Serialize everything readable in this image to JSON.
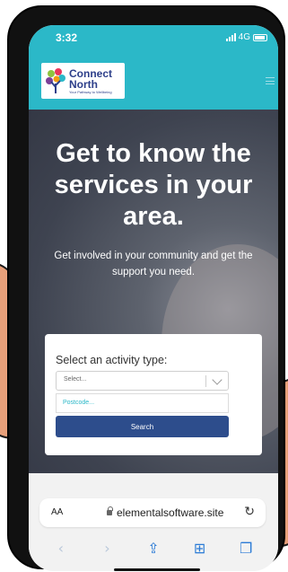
{
  "status": {
    "time": "3:32",
    "network": "4G"
  },
  "header": {
    "logo_title_line1": "Connect",
    "logo_title_line2": "North",
    "logo_tagline": "Your Pathway to Wellbeing"
  },
  "hero": {
    "title": "Get to know the services in your area.",
    "subtitle": "Get involved in your community and get the support you need."
  },
  "search": {
    "label": "Select an activity type:",
    "select_value": "Select...",
    "postcode_placeholder": "Postcode...",
    "button_label": "Search"
  },
  "browser": {
    "text_size_label": "AA",
    "url": "elementalsoftware.site"
  },
  "colors": {
    "brand_teal": "#2bb8c8",
    "brand_navy": "#2d4d8c",
    "ios_blue": "#2b7bd6"
  }
}
